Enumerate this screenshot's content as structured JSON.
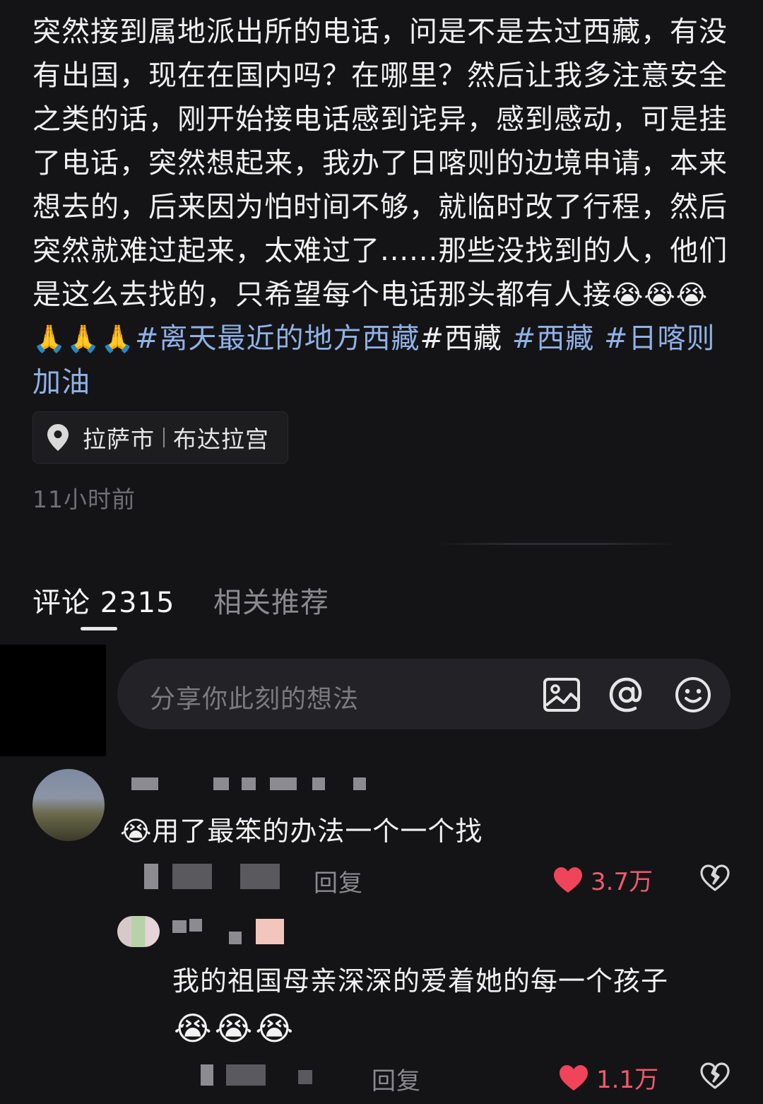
{
  "post": {
    "text_main": "突然接到属地派出所的电话，问是不是去过西藏，有没有出国，现在在国内吗？在哪里？然后让我多注意安全之类的话，刚开始接电话感到诧异，感到感动，可是挂了电话，突然想起来，我办了日喀则的边境申请，本来想去的，后来因为怕时间不够，就临时改了行程，然后突然就难过起来，太难过了......那些没找到的人，他们是这么去找的，只希望每个电话那头都有人接",
    "emojis": "😭😭😭🙏🙏🙏",
    "tag_1": "#离天最近的地方西藏",
    "tag_2": "#西藏",
    "tag_3": "#西藏",
    "tag_4": "#日喀则加油"
  },
  "location": {
    "city": "拉萨市",
    "place": "布达拉宫"
  },
  "time_ago": "11小时前",
  "tabs": {
    "comments": "评论 2315",
    "related": "相关推荐"
  },
  "comment_input": {
    "placeholder": "分享你此刻的想法"
  },
  "comments": [
    {
      "text": "😭用了最笨的办法一个一个找",
      "reply_label": "回复",
      "likes": "3.7万"
    },
    {
      "text": "我的祖国母亲深深的爱着她的每一个孩子",
      "emojis": "😭😭😭",
      "reply_label": "回复",
      "likes": "1.1万"
    }
  ],
  "colors": {
    "background": "#141416",
    "hashtag": "#8fb1e6",
    "like": "#f0596d",
    "muted": "#8a8a8e"
  },
  "icons": [
    "location-pin-icon",
    "image-icon",
    "at-icon",
    "emoji-icon",
    "heart-icon",
    "broken-heart-icon"
  ]
}
